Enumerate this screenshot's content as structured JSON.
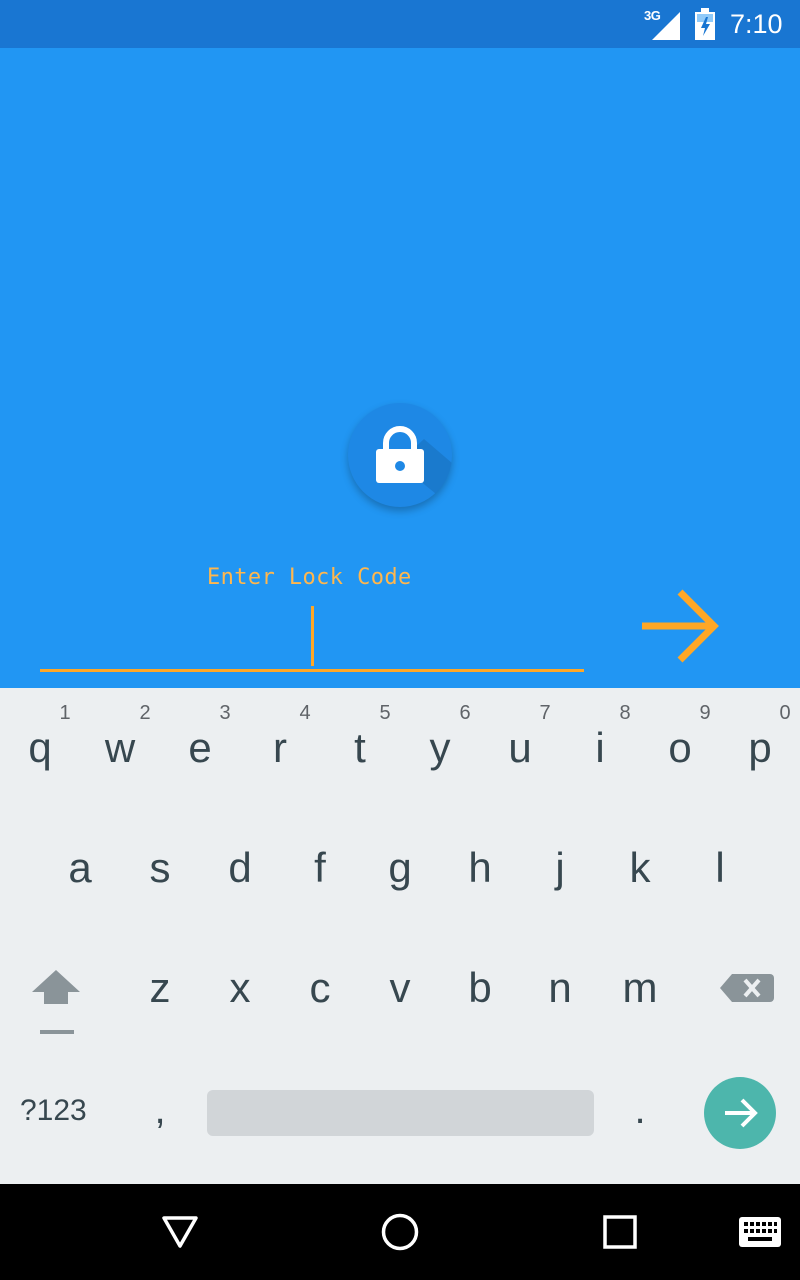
{
  "status_bar": {
    "network": "3G",
    "time": "7:10"
  },
  "lock_screen": {
    "icon": "lock-icon",
    "input_placeholder": "Enter Lock Code",
    "input_value": "",
    "accent_color": "#FFA726",
    "background_color": "#2196F3",
    "submit_icon": "arrow-right-icon"
  },
  "keyboard": {
    "row1": [
      {
        "key": "q",
        "hint": "1"
      },
      {
        "key": "w",
        "hint": "2"
      },
      {
        "key": "e",
        "hint": "3"
      },
      {
        "key": "r",
        "hint": "4"
      },
      {
        "key": "t",
        "hint": "5"
      },
      {
        "key": "y",
        "hint": "6"
      },
      {
        "key": "u",
        "hint": "7"
      },
      {
        "key": "i",
        "hint": "8"
      },
      {
        "key": "o",
        "hint": "9"
      },
      {
        "key": "p",
        "hint": "0"
      }
    ],
    "row2": [
      "a",
      "s",
      "d",
      "f",
      "g",
      "h",
      "j",
      "k",
      "l"
    ],
    "row3": [
      "z",
      "x",
      "c",
      "v",
      "b",
      "n",
      "m"
    ],
    "mode_label": "?123",
    "comma": ",",
    "period": ".",
    "icons": {
      "shift": "shift-icon",
      "backspace": "backspace-icon",
      "enter": "enter-arrow-icon"
    },
    "enter_color": "#4DB6AC"
  },
  "nav_bar": {
    "back": "back-triangle-icon",
    "home": "home-circle-icon",
    "recents": "recents-square-icon",
    "ime_switch": "keyboard-icon"
  }
}
